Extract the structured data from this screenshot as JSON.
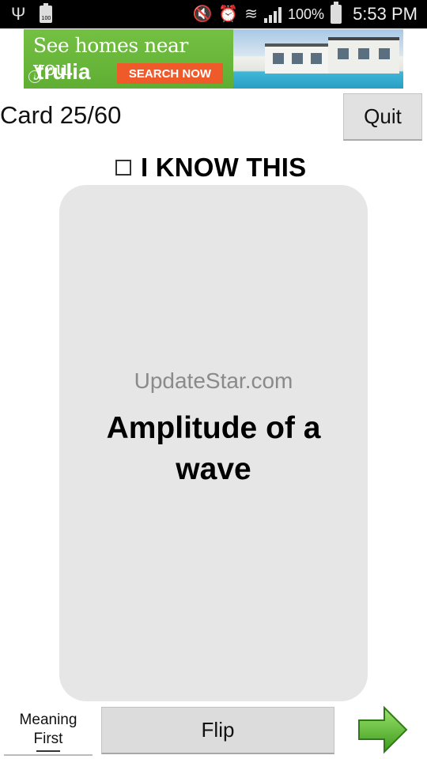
{
  "status_bar": {
    "battery_small_label": "100",
    "battery_percent": "100%",
    "time": "5:53 PM",
    "icons": [
      "usb-icon",
      "battery-icon",
      "mute-icon",
      "alarm-icon",
      "wifi-icon",
      "signal-icon",
      "battery-icon"
    ]
  },
  "ad": {
    "headline": "See homes near you.",
    "brand": "trulia",
    "cta": "SEARCH NOW",
    "colors": {
      "background": "#6cbb3c",
      "cta": "#ef5a2b"
    }
  },
  "header": {
    "card_counter": "Card 25/60",
    "quit_label": "Quit"
  },
  "know_this": {
    "label": "I KNOW THIS",
    "checked": false
  },
  "card": {
    "watermark": "UpdateStar.com",
    "text": "Amplitude of a wave",
    "background": "#e6e6e6"
  },
  "bottom_bar": {
    "meaning_first_line1": "Meaning",
    "meaning_first_line2": "First",
    "flip_label": "Flip",
    "next_icon": "right-arrow-icon",
    "arrow_color": "#4caf2a"
  }
}
